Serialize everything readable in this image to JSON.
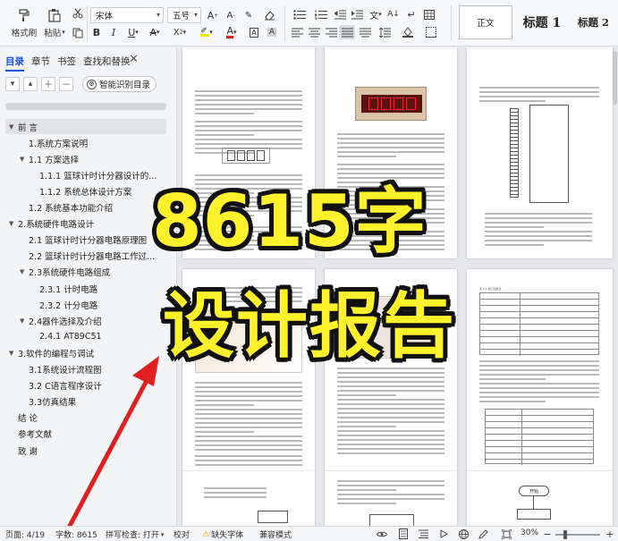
{
  "ribbon": {
    "format_painter": "格式刷",
    "paste": "粘贴",
    "font_name": "宋体",
    "font_size": "五号",
    "styles": [
      "正文",
      "标题 1",
      "标题 2"
    ]
  },
  "nav": {
    "tabs": [
      "目录",
      "章节",
      "书签",
      "查找和替换"
    ],
    "smart_toc": "智能识别目录",
    "toc": [
      {
        "label": "前  言",
        "level": 0,
        "toggle": "▼"
      },
      {
        "label": "1.系统方案说明",
        "level": 1,
        "toggle": ""
      },
      {
        "label": "1.1  方案选择",
        "level": 1,
        "toggle": "▼"
      },
      {
        "label": "1.1.1  篮球计时计分器设计的...",
        "level": 2,
        "toggle": ""
      },
      {
        "label": "1.1.2  系统总体设计方案",
        "level": 2,
        "toggle": ""
      },
      {
        "label": "1.2  系统基本功能介绍",
        "level": 1,
        "toggle": ""
      },
      {
        "label": "2.系统硬件电路设计",
        "level": 0,
        "toggle": "▼"
      },
      {
        "label": "2.1  篮球计时计分器电路原理图",
        "level": 1,
        "toggle": ""
      },
      {
        "label": "2.2  篮球计时计分器电路工作过...",
        "level": 1,
        "toggle": ""
      },
      {
        "label": "2.3系统硬件电路组成",
        "level": 1,
        "toggle": "▼"
      },
      {
        "label": "2.3.1  计时电路",
        "level": 2,
        "toggle": ""
      },
      {
        "label": "2.3.2  计分电路",
        "level": 2,
        "toggle": ""
      },
      {
        "label": "2.4器件选择及介绍",
        "level": 1,
        "toggle": "▼"
      },
      {
        "label": "2.4.1  AT89C51",
        "level": 2,
        "toggle": ""
      },
      {
        "label": "3.软件的编程与调试",
        "level": 0,
        "toggle": "▼"
      },
      {
        "label": "3.1系统设计流程图",
        "level": 1,
        "toggle": ""
      },
      {
        "label": "3.2 C语言程序设计",
        "level": 1,
        "toggle": ""
      },
      {
        "label": "3.3仿真结果",
        "level": 1,
        "toggle": ""
      },
      {
        "label": "结  论",
        "level": 0,
        "toggle": ""
      },
      {
        "label": "参考文献",
        "level": 0,
        "toggle": ""
      },
      {
        "label": "致  谢",
        "level": 0,
        "toggle": ""
      }
    ]
  },
  "overlay": {
    "line1": "8615字",
    "line2": "设计报告"
  },
  "page_labels": {
    "table_title": "表 2.1 端口功能表",
    "flow_start": "开始"
  },
  "status": {
    "page": "页面: 4/19",
    "words": "字数: 8615",
    "spell": "拼写检查: 打开",
    "proof": "校对",
    "missing_font": "缺失字体",
    "compat": "兼容模式",
    "zoom": "30%"
  },
  "colors": {
    "accent": "#1a56db",
    "overlay_text": "#fff22d",
    "arrow": "#e02020"
  }
}
